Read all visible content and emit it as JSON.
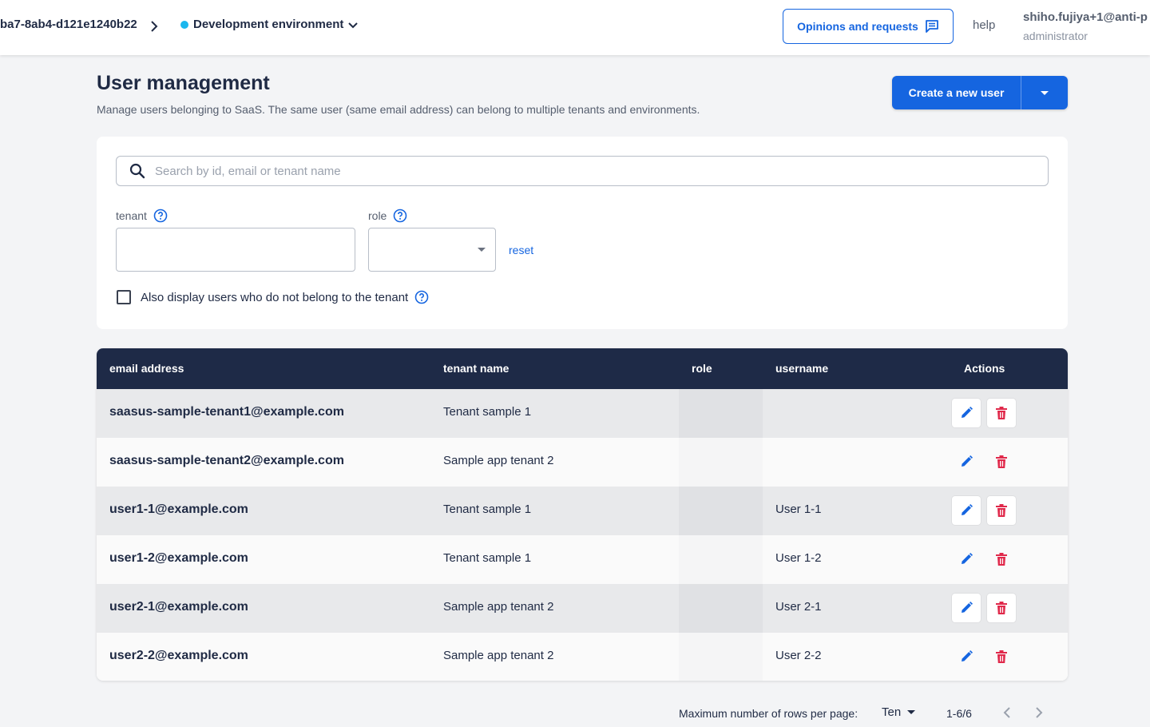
{
  "header": {
    "breadcrumb_id": "ba7-8ab4-d121e1240b22",
    "environment": "Development environment",
    "opinions_label": "Opinions and requests",
    "help_label": "help",
    "user_email": "shiho.fujiya+1@anti-p",
    "user_role": "administrator",
    "env_dot_color": "#1bb7ee"
  },
  "page": {
    "title": "User management",
    "description": "Manage users belonging to SaaS. The same user (same email address) can belong to multiple tenants and environments.",
    "create_label": "Create a new user"
  },
  "filters": {
    "search_placeholder": "Search by id, email or tenant name",
    "tenant_label": "tenant",
    "role_label": "role",
    "reset_label": "reset",
    "checkbox_label": "Also display users who do not belong to the tenant"
  },
  "table": {
    "headers": {
      "email": "email address",
      "tenant": "tenant name",
      "role": "role",
      "username": "username",
      "actions": "Actions"
    },
    "rows": [
      {
        "email": "saasus-sample-tenant1@example.com",
        "tenant": "Tenant sample 1",
        "role": "",
        "username": ""
      },
      {
        "email": "saasus-sample-tenant2@example.com",
        "tenant": "Sample app tenant 2",
        "role": "",
        "username": ""
      },
      {
        "email": "user1-1@example.com",
        "tenant": "Tenant sample 1",
        "role": "",
        "username": "User 1-1"
      },
      {
        "email": "user1-2@example.com",
        "tenant": "Tenant sample 1",
        "role": "",
        "username": "User 1-2"
      },
      {
        "email": "user2-1@example.com",
        "tenant": "Sample app tenant 2",
        "role": "",
        "username": "User 2-1"
      },
      {
        "email": "user2-2@example.com",
        "tenant": "Sample app tenant 2",
        "role": "",
        "username": "User 2-2"
      }
    ]
  },
  "pagination": {
    "rows_per_page_label": "Maximum number of rows per page:",
    "rows_per_page_value": "Ten",
    "range": "1-6/6"
  },
  "colors": {
    "primary": "#1565e0",
    "table_header": "#1e2a47",
    "delete": "#e0284a"
  }
}
